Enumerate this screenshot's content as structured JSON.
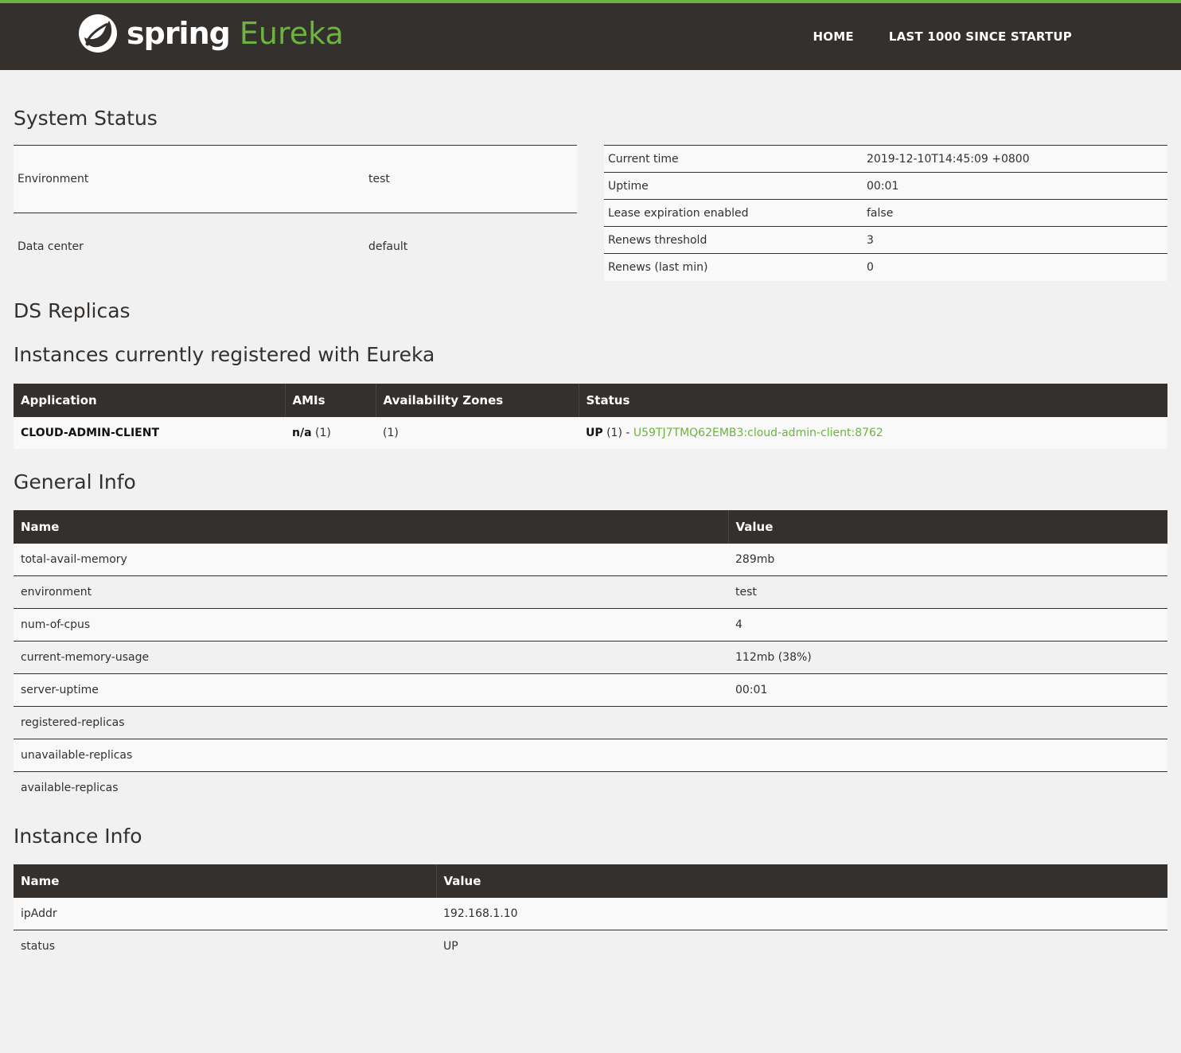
{
  "brand": {
    "spring": "spring",
    "product": "Eureka"
  },
  "nav": {
    "home": "HOME",
    "last1000": "LAST 1000 SINCE STARTUP"
  },
  "colors": {
    "accent": "#6db33f",
    "dark": "#34302d",
    "background": "#f1f1f1"
  },
  "system_status": {
    "title": "System Status",
    "left": [
      {
        "key": "Environment",
        "value": "test"
      },
      {
        "key": "Data center",
        "value": "default"
      }
    ],
    "right": [
      {
        "key": "Current time",
        "value": "2019-12-10T14:45:09 +0800"
      },
      {
        "key": "Uptime",
        "value": "00:01"
      },
      {
        "key": "Lease expiration enabled",
        "value": "false"
      },
      {
        "key": "Renews threshold",
        "value": "3"
      },
      {
        "key": "Renews (last min)",
        "value": "0"
      }
    ]
  },
  "ds_replicas": {
    "title": "DS Replicas"
  },
  "instances": {
    "title": "Instances currently registered with Eureka",
    "headers": [
      "Application",
      "AMIs",
      "Availability Zones",
      "Status"
    ],
    "rows": [
      {
        "application": "CLOUD-ADMIN-CLIENT",
        "amis_bold": "n/a",
        "amis_count": " (1)",
        "zones": "(1)",
        "status_bold": "UP",
        "status_count": " (1) - ",
        "instance_link": "U59TJ7TMQ62EMB3:cloud-admin-client:8762"
      }
    ]
  },
  "general_info": {
    "title": "General Info",
    "headers": [
      "Name",
      "Value"
    ],
    "rows": [
      {
        "name": "total-avail-memory",
        "value": "289mb"
      },
      {
        "name": "environment",
        "value": "test"
      },
      {
        "name": "num-of-cpus",
        "value": "4"
      },
      {
        "name": "current-memory-usage",
        "value": "112mb (38%)"
      },
      {
        "name": "server-uptime",
        "value": "00:01"
      },
      {
        "name": "registered-replicas",
        "value": ""
      },
      {
        "name": "unavailable-replicas",
        "value": ""
      },
      {
        "name": "available-replicas",
        "value": ""
      }
    ]
  },
  "instance_info": {
    "title": "Instance Info",
    "headers": [
      "Name",
      "Value"
    ],
    "rows": [
      {
        "name": "ipAddr",
        "value": "192.168.1.10"
      },
      {
        "name": "status",
        "value": "UP"
      }
    ]
  }
}
